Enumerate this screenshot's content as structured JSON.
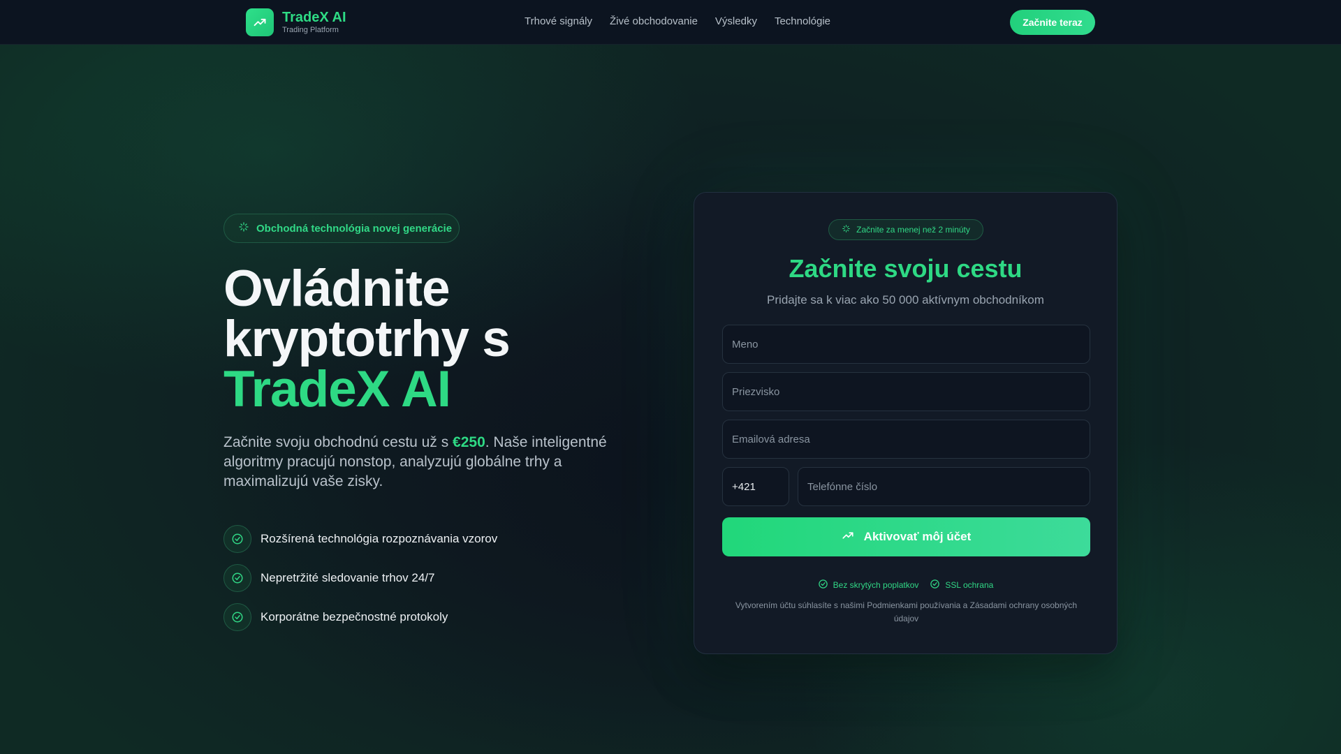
{
  "brand": {
    "name": "TradeX AI",
    "tagline": "Trading Platform",
    "accent_color": "#2edc85"
  },
  "nav": {
    "links": [
      "Trhové signály",
      "Živé obchodovanie",
      "Výsledky",
      "Technológie"
    ],
    "cta_label": "Začnite teraz"
  },
  "hero": {
    "badge_label": "Obchodná technológia novej generácie",
    "title_line1": "Ovládnite",
    "title_line2": "kryptotrhy s",
    "title_accent": "TradeX AI",
    "desc_before": "Začnite svoju obchodnú cestu už s ",
    "desc_price": "€250",
    "desc_after": ". Naše inteligentné algoritmy pracujú nonstop, analyzujú globálne trhy a maximalizujú vaše zisky.",
    "features": [
      "Rozšírená technológia rozpoznávania vzorov",
      "Nepretržité sledovanie trhov 24/7",
      "Korporátne bezpečnostné protokoly"
    ]
  },
  "form": {
    "badge_label": "Začnite za menej než 2 minúty",
    "title": "Začnite svoju cestu",
    "subtitle": "Pridajte sa k viac ako 50 000 aktívnym obchodníkom",
    "first_name_placeholder": "Meno",
    "last_name_placeholder": "Priezvisko",
    "email_placeholder": "Emailová adresa",
    "phone_code_value": "+421",
    "phone_placeholder": "Telefónne číslo",
    "submit_label": "Aktivovať môj účet",
    "trust_fees": "Bez skrytých poplatkov",
    "trust_ssl": "SSL ochrana",
    "legal": "Vytvorením účtu súhlasíte s našimi Podmienkami používania a Zásadami ochrany osobných údajov"
  }
}
